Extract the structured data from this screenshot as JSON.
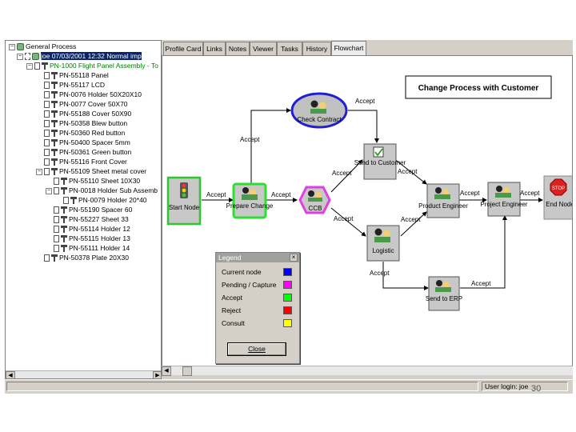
{
  "tree": {
    "items": [
      {
        "label": "General Process",
        "type": "root"
      },
      {
        "label": "joe 07/03/2001 12:32      Normal imp",
        "type": "user"
      },
      {
        "label": "PN-1000 Flight Panel Assembly - To",
        "type": "assembly"
      },
      {
        "label": "PN-55118 Panel"
      },
      {
        "label": "PN-55117 LCD"
      },
      {
        "label": "PN-0076 Holder 50X20X10"
      },
      {
        "label": "PN-0077 Cover 50X70"
      },
      {
        "label": "PN-55188 Cover 50X90"
      },
      {
        "label": "PN-50358 Blew button"
      },
      {
        "label": "PN-50360 Red button"
      },
      {
        "label": "PN-50400 Spacer 5mm"
      },
      {
        "label": "PN-50361 Green button"
      },
      {
        "label": "PN-55116 Front Cover"
      },
      {
        "label": "PN-55109 Sheet metal cover"
      },
      {
        "label": "PN-55110 Sheet 10X30"
      },
      {
        "label": "PN-0018 Holder Sub Assemb"
      },
      {
        "label": "PN-0079 Holder 20*40"
      },
      {
        "label": "PN-55190 Spacer 60"
      },
      {
        "label": "PN-55227 Sheet 33"
      },
      {
        "label": "PN-55114 Holder 12"
      },
      {
        "label": "PN-55115 Holder 13"
      },
      {
        "label": "PN-55111 Holder 14"
      },
      {
        "label": "PN-50378 Plate 20X30"
      }
    ]
  },
  "tabs": [
    {
      "label": "Profile Card"
    },
    {
      "label": "Links"
    },
    {
      "label": "Notes"
    },
    {
      "label": "Viewer"
    },
    {
      "label": "Tasks"
    },
    {
      "label": "History"
    },
    {
      "label": "Flowchart",
      "active": true
    }
  ],
  "flowchart": {
    "title": "Change Process with Customer",
    "nodes": {
      "start": "Start Node",
      "prepare": "Prepare Change",
      "ccb": "CCB",
      "check": "Check Contract",
      "send_customer": "Send to Customer",
      "product_engineer": "Product Engineer",
      "project_engineer": "Project Engineer",
      "end": "End Node",
      "stop_sign": "STOP",
      "logistic": "Logistic",
      "send_erp": "Send to ERP"
    },
    "edge_label": "Accept"
  },
  "legend": {
    "title": "Legend",
    "close_x": "×",
    "items": [
      {
        "label": "Current node",
        "color": "#0000ff"
      },
      {
        "label": "Pending / Capture",
        "color": "#ff00ff"
      },
      {
        "label": "Accept",
        "color": "#00ff00"
      },
      {
        "label": "Reject",
        "color": "#ff0000"
      },
      {
        "label": "Consult",
        "color": "#ffff00"
      }
    ],
    "close_button": "Close"
  },
  "status": {
    "user_login": "User login: joe"
  },
  "slide_number": "30"
}
